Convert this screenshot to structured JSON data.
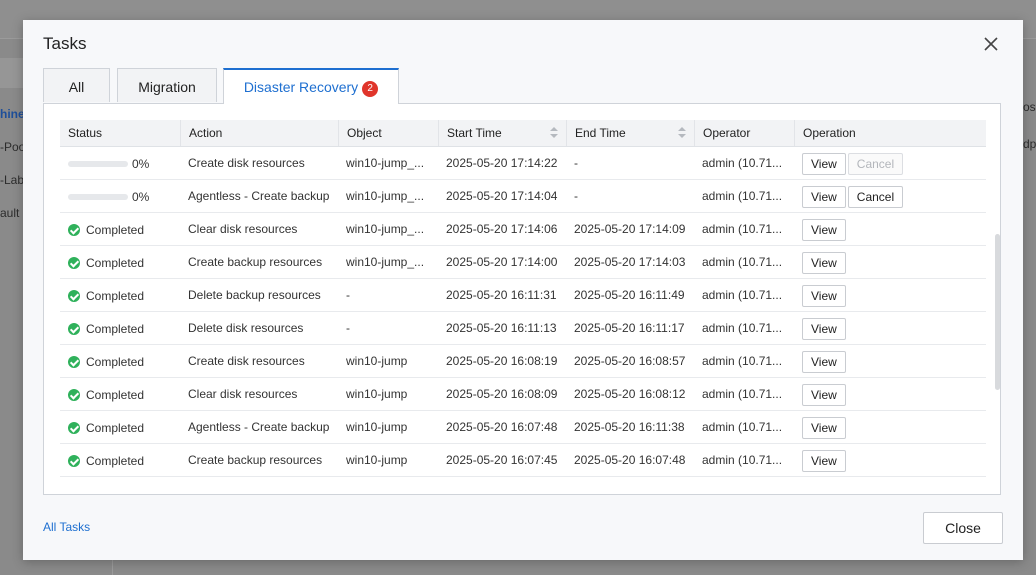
{
  "background": {
    "left_fragments": [
      "hine",
      "-Poo",
      "-Lab",
      "ault C"
    ],
    "right_fragments": [
      "os",
      "dp"
    ]
  },
  "dialog": {
    "title": "Tasks",
    "close_icon": "close-icon"
  },
  "tabs": [
    {
      "label": "All"
    },
    {
      "label": "Migration"
    },
    {
      "label": "Disaster Recovery",
      "badge": "2",
      "active": true
    }
  ],
  "table": {
    "headers": [
      "Status",
      "Action",
      "Object",
      "Start Time",
      "End Time",
      "Operator",
      "Operation"
    ],
    "rows": [
      {
        "status_type": "progress",
        "progress": 0,
        "status": "0%",
        "action": "Create disk resources",
        "object": "win10-jump_...",
        "start": "2025-05-20 17:14:22",
        "end": "-",
        "operator": "admin (10.71...",
        "ops": [
          "View",
          "Cancel"
        ],
        "cancel_disabled": true
      },
      {
        "status_type": "progress",
        "progress": 0,
        "status": "0%",
        "action": "Agentless - Create backup",
        "object": "win10-jump_...",
        "start": "2025-05-20 17:14:04",
        "end": "-",
        "operator": "admin (10.71...",
        "ops": [
          "View",
          "Cancel"
        ],
        "cancel_disabled": false
      },
      {
        "status_type": "done",
        "status": "Completed",
        "action": "Clear disk resources",
        "object": "win10-jump_...",
        "start": "2025-05-20 17:14:06",
        "end": "2025-05-20 17:14:09",
        "operator": "admin (10.71...",
        "ops": [
          "View"
        ]
      },
      {
        "status_type": "done",
        "status": "Completed",
        "action": "Create backup resources",
        "object": "win10-jump_...",
        "start": "2025-05-20 17:14:00",
        "end": "2025-05-20 17:14:03",
        "operator": "admin (10.71...",
        "ops": [
          "View"
        ]
      },
      {
        "status_type": "done",
        "status": "Completed",
        "action": "Delete backup resources",
        "object": "-",
        "start": "2025-05-20 16:11:31",
        "end": "2025-05-20 16:11:49",
        "operator": "admin (10.71...",
        "ops": [
          "View"
        ]
      },
      {
        "status_type": "done",
        "status": "Completed",
        "action": "Delete disk resources",
        "object": "-",
        "start": "2025-05-20 16:11:13",
        "end": "2025-05-20 16:11:17",
        "operator": "admin (10.71...",
        "ops": [
          "View"
        ]
      },
      {
        "status_type": "done",
        "status": "Completed",
        "action": "Create disk resources",
        "object": "win10-jump",
        "start": "2025-05-20 16:08:19",
        "end": "2025-05-20 16:08:57",
        "operator": "admin (10.71...",
        "ops": [
          "View"
        ]
      },
      {
        "status_type": "done",
        "status": "Completed",
        "action": "Clear disk resources",
        "object": "win10-jump",
        "start": "2025-05-20 16:08:09",
        "end": "2025-05-20 16:08:12",
        "operator": "admin (10.71...",
        "ops": [
          "View"
        ]
      },
      {
        "status_type": "done",
        "status": "Completed",
        "action": "Agentless - Create backup",
        "object": "win10-jump",
        "start": "2025-05-20 16:07:48",
        "end": "2025-05-20 16:11:38",
        "operator": "admin (10.71...",
        "ops": [
          "View"
        ]
      },
      {
        "status_type": "done",
        "status": "Completed",
        "action": "Create backup resources",
        "object": "win10-jump",
        "start": "2025-05-20 16:07:45",
        "end": "2025-05-20 16:07:48",
        "operator": "admin (10.71...",
        "ops": [
          "View"
        ]
      }
    ]
  },
  "footer": {
    "all_tasks_link": "All Tasks",
    "close_label": "Close"
  },
  "colors": {
    "accent": "#1e6fd0",
    "success": "#2fb15b",
    "badge": "#e0352b"
  }
}
